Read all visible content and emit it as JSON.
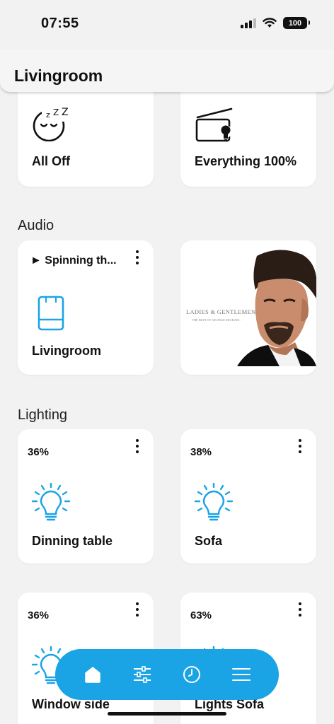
{
  "status_bar": {
    "time": "07:55",
    "battery": "100"
  },
  "header": {
    "title": "Livingroom"
  },
  "scenes": [
    {
      "label": "All Off"
    },
    {
      "label": "Everything 100%"
    }
  ],
  "audio": {
    "section_title": "Audio",
    "now_playing": "► Spinning th...",
    "room_label": "Livingroom",
    "album": {
      "title": "LADIES & GENTLEMEN",
      "subtitle": "THE BEST OF GEORGE MICHAEL"
    }
  },
  "lighting": {
    "section_title": "Lighting",
    "lights": [
      {
        "percent": "36%",
        "name": "Dinning table"
      },
      {
        "percent": "38%",
        "name": "Sofa"
      },
      {
        "percent": "36%",
        "name": "Window side"
      },
      {
        "percent": "63%",
        "name": "Lights Sofa"
      }
    ]
  },
  "colors": {
    "accent": "#1aa4e5",
    "background": "#f2f2f3",
    "card": "#ffffff"
  },
  "bottom_nav": {
    "items": [
      "home-icon",
      "sliders-icon",
      "clock-icon",
      "menu-icon"
    ]
  }
}
